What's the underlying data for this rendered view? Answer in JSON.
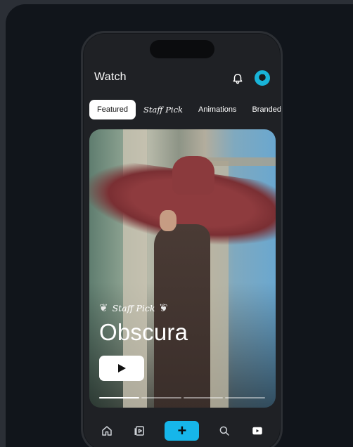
{
  "header": {
    "title": "Watch"
  },
  "tabs": [
    {
      "label": "Featured",
      "active": true
    },
    {
      "label": "Staff Pick",
      "active": false
    },
    {
      "label": "Animations",
      "active": false
    },
    {
      "label": "Branded c",
      "active": false
    }
  ],
  "hero": {
    "award": "Staff Pick",
    "title": "Obscura",
    "progress": {
      "segments": 4,
      "current": 1
    }
  },
  "nav": [
    {
      "icon": "home-icon"
    },
    {
      "icon": "video-library-icon"
    },
    {
      "icon": "plus-icon",
      "label": "+"
    },
    {
      "icon": "search-icon"
    },
    {
      "icon": "play-square-icon"
    }
  ],
  "colors": {
    "accent": "#16b6ea",
    "background": "#11151b",
    "phone": "#1f2125"
  }
}
